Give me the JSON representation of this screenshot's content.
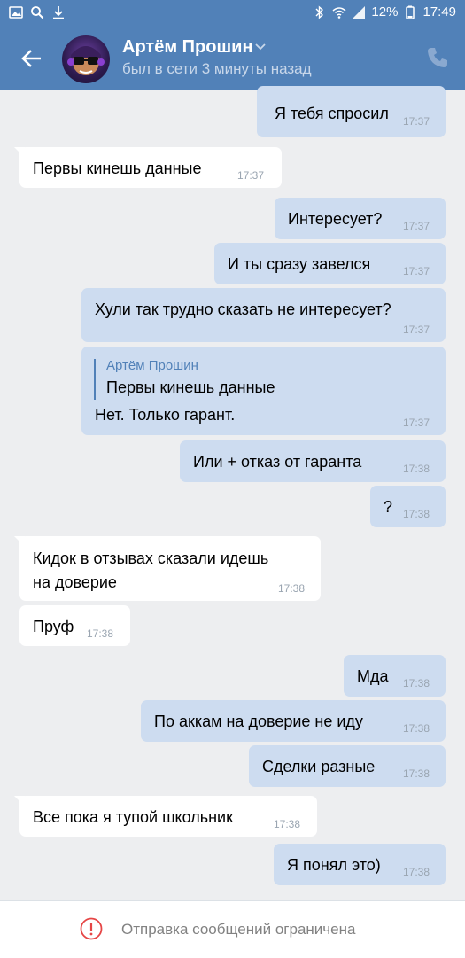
{
  "statusbar": {
    "battery": "12%",
    "time": "17:49"
  },
  "header": {
    "name": "Артём Прошин",
    "status": "был в сети 3 минуты назад"
  },
  "messages": [
    {
      "dir": "out",
      "text": "Я тебя спросил",
      "time": "17:37"
    },
    {
      "dir": "in",
      "text": "Первы кинешь данные",
      "time": "17:37"
    },
    {
      "dir": "out",
      "text": "Интересует?",
      "time": "17:37"
    },
    {
      "dir": "out",
      "text": "И ты сразу завелся",
      "time": "17:37"
    },
    {
      "dir": "out",
      "text": "Хули так трудно сказать не интересует?",
      "time": "17:37"
    },
    {
      "dir": "out",
      "forward_author": "Артём Прошин",
      "forward_text": "Первы кинешь данные",
      "text": "Нет. Только гарант.",
      "time": "17:37"
    },
    {
      "dir": "out",
      "text": "Или  + отказ от гаранта",
      "time": "17:38"
    },
    {
      "dir": "out",
      "text": "?",
      "time": "17:38"
    },
    {
      "dir": "in",
      "text_line1": "Кидок в отзывах сказали идешь",
      "text_line2": "на доверие",
      "time": "17:38"
    },
    {
      "dir": "in",
      "text": "Пруф",
      "time": "17:38"
    },
    {
      "dir": "out",
      "text": "Мда",
      "time": "17:38"
    },
    {
      "dir": "out",
      "text": "По аккам на доверие не иду",
      "time": "17:38"
    },
    {
      "dir": "out",
      "text": "Сделки разные",
      "time": "17:38"
    },
    {
      "dir": "in",
      "text": "Все пока я тупой школьник",
      "time": "17:38"
    },
    {
      "dir": "out",
      "text": "Я понял это)",
      "time": "17:38"
    }
  ],
  "footer": {
    "notice": "Отправка сообщений ограничена"
  },
  "colors": {
    "header": "#5181b8",
    "outgoing": "#cddcf0",
    "incoming": "#ffffff",
    "background": "#edeef0",
    "warning": "#e64646"
  }
}
